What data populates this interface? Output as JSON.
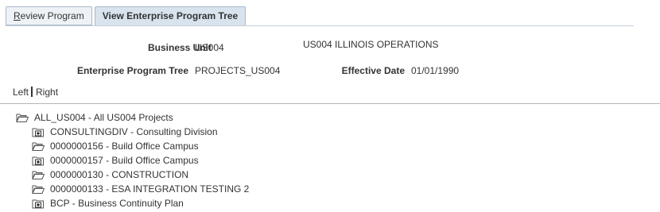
{
  "tabs": [
    {
      "label": "Review Program",
      "active": false
    },
    {
      "label": "View Enterprise Program Tree",
      "active": true
    }
  ],
  "header": {
    "business_unit_label": "Business Unit",
    "business_unit_value": "US004",
    "business_unit_desc": "US004 ILLINOIS OPERATIONS",
    "program_tree_label": "Enterprise Program Tree",
    "program_tree_value": "PROJECTS_US004",
    "effective_date_label": "Effective Date",
    "effective_date_value": "01/01/1990"
  },
  "nav": {
    "left": "Left",
    "right": "Right"
  },
  "tree": {
    "root": {
      "label": "ALL_US004 - All US004 Projects",
      "icon": "open-folder-icon"
    },
    "children": [
      {
        "label": "CONSULTINGDIV - Consulting Division",
        "icon": "expand-folder-icon"
      },
      {
        "label": "0000000156 - Build Office Campus",
        "icon": "open-folder-icon"
      },
      {
        "label": "0000000157 - Build Office Campus",
        "icon": "expand-folder-icon"
      },
      {
        "label": "0000000130 - CONSTRUCTION",
        "icon": "open-folder-icon"
      },
      {
        "label": "0000000133 - ESA INTEGRATION TESTING 2",
        "icon": "open-folder-icon"
      },
      {
        "label": "BCP - Business Continuity Plan",
        "icon": "expand-folder-icon"
      }
    ]
  }
}
